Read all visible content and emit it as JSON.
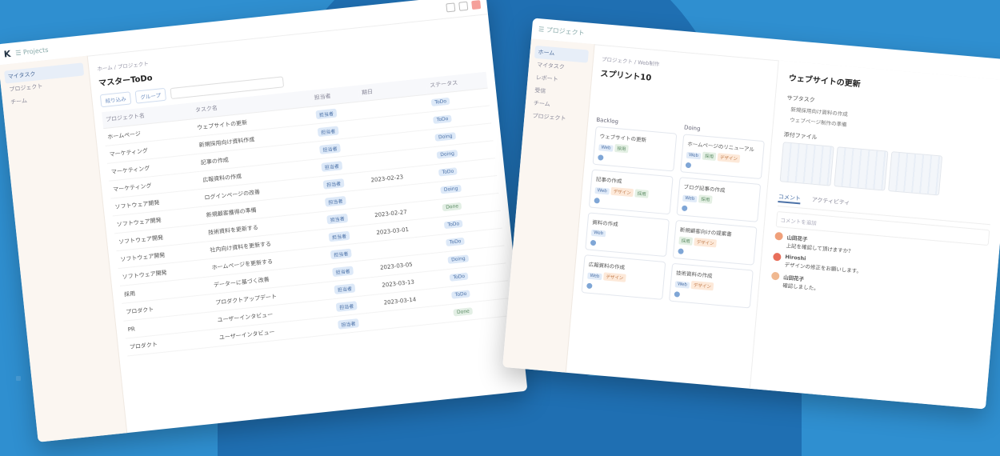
{
  "colors": {
    "background": "#2f8fd0",
    "circle": "#1f6fb2",
    "accent": "#4c72a8"
  },
  "win1": {
    "app_title": "Projects",
    "sidebar": [
      "マイタスク",
      "プロジェクト",
      "チーム"
    ],
    "breadcrumb": "ホーム / プロジェクト",
    "page_title": "マスターToDo",
    "filter_label": "絞り込み",
    "group_label": "グループ",
    "columns": [
      "プロジェクト名",
      "タスク名",
      "担当者",
      "期日",
      "ステータス"
    ],
    "rows": [
      {
        "project": "ホームページ",
        "task": "ウェブサイトの更新",
        "assignee": "担当者",
        "date": "",
        "status": "ToDo"
      },
      {
        "project": "マーケティング",
        "task": "新規採用向け資料作成",
        "assignee": "担当者",
        "date": "",
        "status": "ToDo"
      },
      {
        "project": "マーケティング",
        "task": "記事の作成",
        "assignee": "担当者",
        "date": "",
        "status": "Doing"
      },
      {
        "project": "マーケティング",
        "task": "広報資料の作成",
        "assignee": "担当者",
        "date": "",
        "status": "Doing"
      },
      {
        "project": "ソフトウェア開発",
        "task": "ログインページの改善",
        "assignee": "担当者",
        "date": "2023-02-23",
        "status": "ToDo"
      },
      {
        "project": "ソフトウェア開発",
        "task": "新規顧客獲得の準備",
        "assignee": "担当者",
        "date": "",
        "status": "Doing"
      },
      {
        "project": "ソフトウェア開発",
        "task": "技術資料を更新する",
        "assignee": "担当者",
        "date": "2023-02-27",
        "status": "Done"
      },
      {
        "project": "ソフトウェア開発",
        "task": "社内向け資料を更新する",
        "assignee": "担当者",
        "date": "2023-03-01",
        "status": "ToDo"
      },
      {
        "project": "ソフトウェア開発",
        "task": "ホームページを更新する",
        "assignee": "担当者",
        "date": "",
        "status": "ToDo"
      },
      {
        "project": "採用",
        "task": "データーに基づく改善",
        "assignee": "担当者",
        "date": "2023-03-05",
        "status": "Doing"
      },
      {
        "project": "プロダクト",
        "task": "プロダクトアップデート",
        "assignee": "担当者",
        "date": "2023-03-13",
        "status": "ToDo"
      },
      {
        "project": "PR",
        "task": "ユーザーインタビュー",
        "assignee": "担当者",
        "date": "2023-03-14",
        "status": "ToDo"
      },
      {
        "project": "プロダクト",
        "task": "ユーザーインタビュー",
        "assignee": "担当者",
        "date": "",
        "status": "Done"
      }
    ]
  },
  "win2": {
    "app_title": "プロジェクト",
    "sidebar": [
      "ホーム",
      "マイタスク",
      "レポート",
      "受信",
      "チーム",
      "プロジェクト"
    ],
    "breadcrumb": "プロジェクト / Web制作",
    "page_title": "スプリント10",
    "col1_title": "Backlog",
    "col2_title": "Doing",
    "col1_cards": [
      {
        "title": "ウェブサイトの更新",
        "tags": [
          "Web",
          "採用"
        ]
      },
      {
        "title": "記事の作成",
        "tags": [
          "Web",
          "デザイン",
          "採用"
        ]
      },
      {
        "title": "資料の作成",
        "tags": [
          "Web"
        ]
      },
      {
        "title": "広報資料の作成",
        "tags": [
          "Web",
          "デザイン"
        ]
      }
    ],
    "col2_cards": [
      {
        "title": "ホームページのリニューアル",
        "tags": [
          "Web",
          "採用",
          "デザイン"
        ]
      },
      {
        "title": "ブログ記事の作成",
        "tags": [
          "Web",
          "採用"
        ]
      },
      {
        "title": "新規顧客向けの提案書",
        "tags": [
          "採用",
          "デザイン"
        ]
      },
      {
        "title": "技術資料の作成",
        "tags": [
          "Web",
          "デザイン"
        ]
      }
    ],
    "detail": {
      "title": "ウェブサイトの更新",
      "section1": "サブタスク",
      "sub1": "新規採用向け資料の作成",
      "sub2": "ウェブページ制作の準備",
      "section2": "添付ファイル",
      "tabs": [
        "コメント",
        "アクティビティ"
      ],
      "comment_placeholder": "コメントを追加",
      "comments": [
        {
          "author": "山田花子",
          "text": "上記を確認して頂けますか？"
        },
        {
          "author": "Hiroshi",
          "text": "デザインの修正をお願いします。"
        },
        {
          "author": "山田花子",
          "text": "確認しました。"
        }
      ]
    }
  }
}
